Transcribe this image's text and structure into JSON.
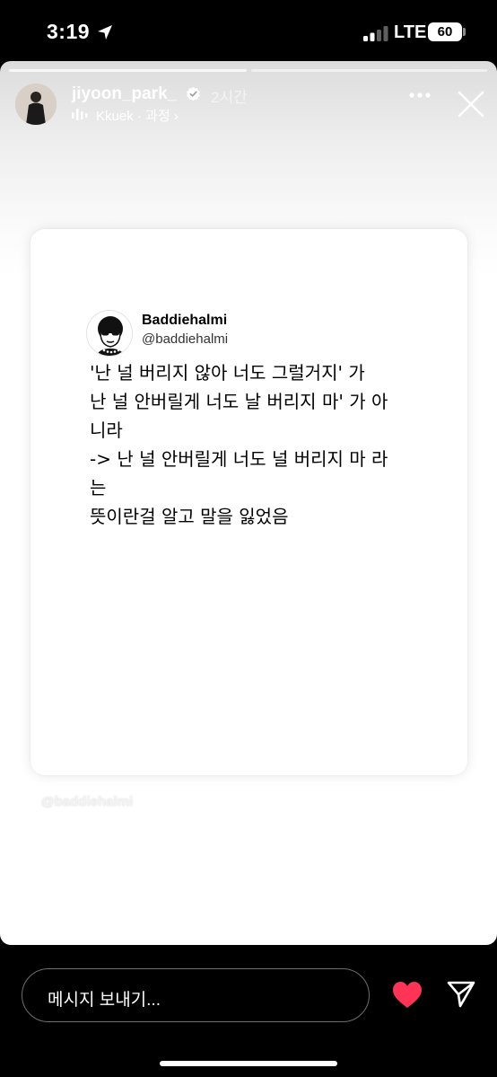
{
  "status_bar": {
    "time": "3:19",
    "carrier": "LTE",
    "battery": "60"
  },
  "story": {
    "username": "jiyoon_park_",
    "time_ago": "2시간",
    "music": "Kkuek · 과정 ›"
  },
  "tweet": {
    "name": "Baddiehalmi",
    "handle": "@baddiehalmi",
    "lines": [
      "'난 널 버리지 않아 너도 그럴거지' 가",
      "난 널 안버릴게 너도 날 버리지 마' 가 아",
      "니라",
      "-> 난 널 안버릴게 너도 널 버리지 마 라",
      "는",
      "뜻이란걸 알고 말을 잃었음"
    ]
  },
  "watermark": "@baddiehalmi",
  "reply": {
    "placeholder": "메시지 보내기..."
  },
  "colors": {
    "heart": "#ff3355",
    "background": "#000000",
    "card": "#ffffff"
  },
  "icons": [
    "location-arrow-icon",
    "signal-icon",
    "verified-badge-icon",
    "music-bars-icon",
    "more-icon",
    "close-icon",
    "heart-icon",
    "send-icon"
  ]
}
